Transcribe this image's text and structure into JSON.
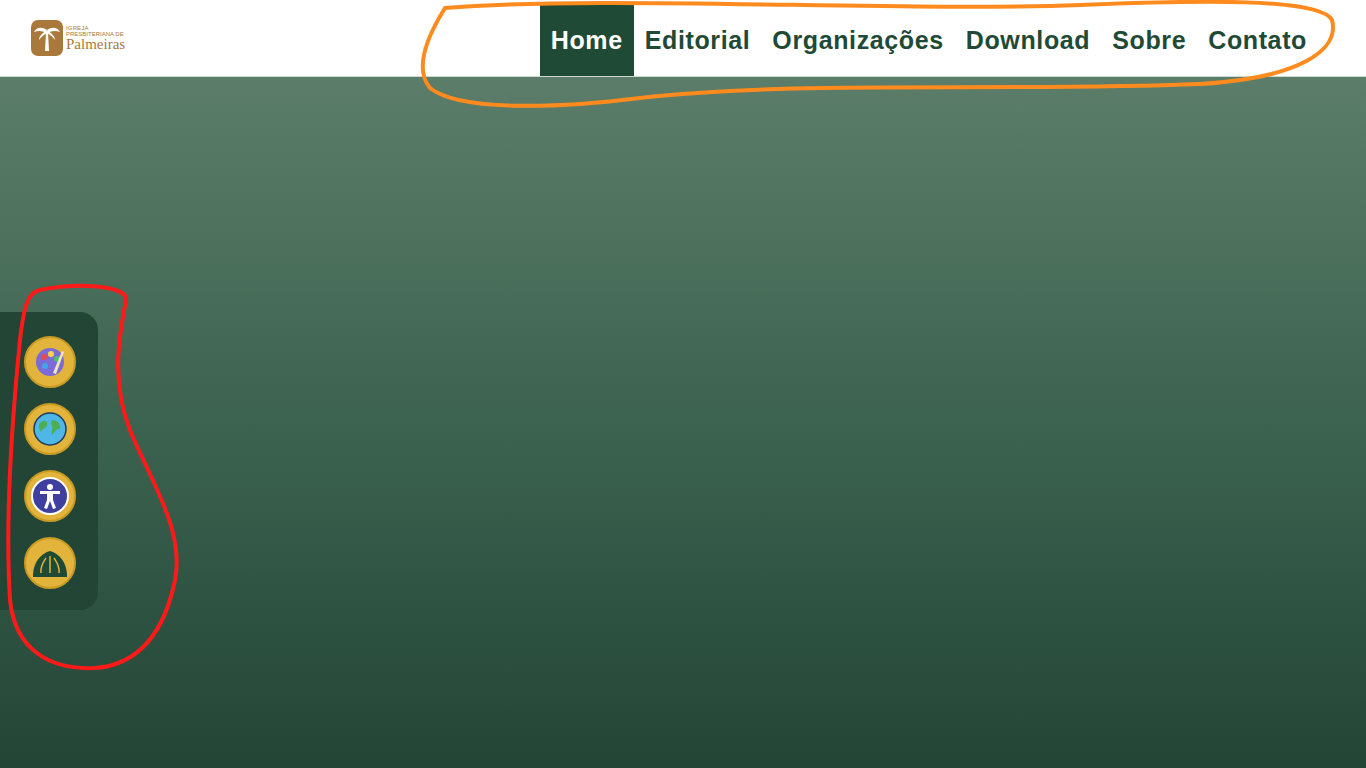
{
  "logo": {
    "line1": "IGREJA",
    "line2": "PRESBITERIANA DE",
    "name": "Palmeiras"
  },
  "nav": [
    {
      "label": "Home",
      "selected": true
    },
    {
      "label": "Editorial",
      "selected": false
    },
    {
      "label": "Organizações",
      "selected": false
    },
    {
      "label": "Download",
      "selected": false
    },
    {
      "label": "Sobre",
      "selected": false
    },
    {
      "label": "Contato",
      "selected": false
    }
  ]
}
